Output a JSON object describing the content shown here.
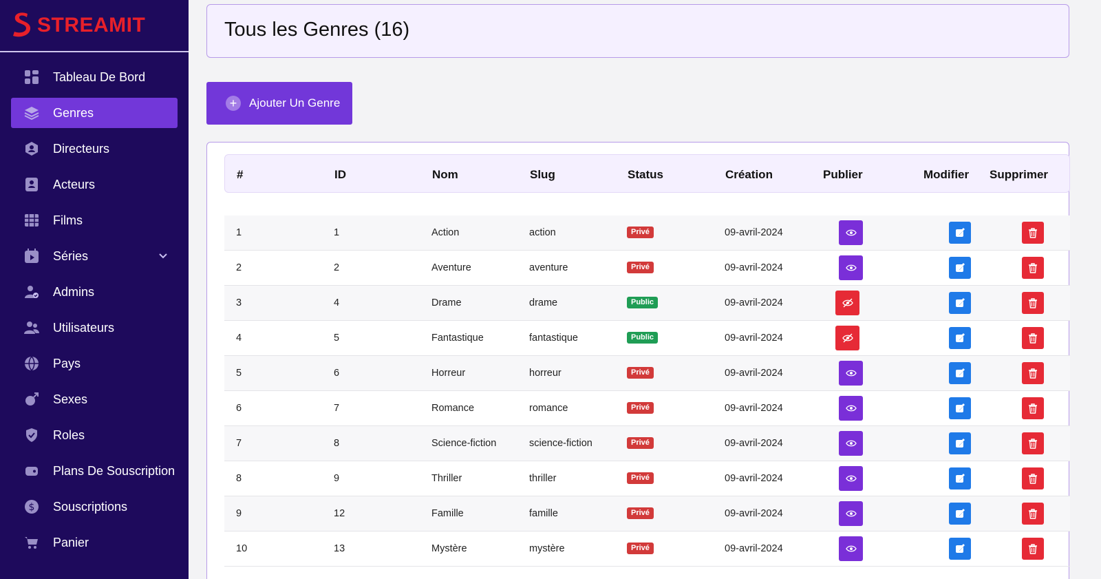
{
  "brand": {
    "name": "STREAMIT"
  },
  "sidebar": {
    "items": [
      {
        "label": "Tableau De Bord",
        "icon": "dashboard-icon",
        "active": false
      },
      {
        "label": "Genres",
        "icon": "layers-icon",
        "active": true
      },
      {
        "label": "Directeurs",
        "icon": "director-icon",
        "active": false
      },
      {
        "label": "Acteurs",
        "icon": "actor-icon",
        "active": false
      },
      {
        "label": "Films",
        "icon": "film-icon",
        "active": false
      },
      {
        "label": "Séries",
        "icon": "series-icon",
        "active": false,
        "has_submenu": true
      },
      {
        "label": "Admins",
        "icon": "admin-icon",
        "active": false
      },
      {
        "label": "Utilisateurs",
        "icon": "users-icon",
        "active": false
      },
      {
        "label": "Pays",
        "icon": "globe-icon",
        "active": false
      },
      {
        "label": "Sexes",
        "icon": "gender-icon",
        "active": false
      },
      {
        "label": "Roles",
        "icon": "shield-icon",
        "active": false
      },
      {
        "label": "Plans De Souscription",
        "icon": "plan-icon",
        "active": false
      },
      {
        "label": "Souscriptions",
        "icon": "dollar-icon",
        "active": false
      },
      {
        "label": "Panier",
        "icon": "cart-icon",
        "active": false
      }
    ]
  },
  "header": {
    "title": "Tous les Genres (16)"
  },
  "toolbar": {
    "add_label": "Ajouter Un Genre"
  },
  "table": {
    "columns": [
      "#",
      "ID",
      "Nom",
      "Slug",
      "Status",
      "Création",
      "Publier",
      "Modifier",
      "Supprimer"
    ],
    "rows": [
      {
        "n": "1",
        "id": "1",
        "name": "Action",
        "slug": "action",
        "status": "Privé",
        "created": "09-avril-2024"
      },
      {
        "n": "2",
        "id": "2",
        "name": "Aventure",
        "slug": "aventure",
        "status": "Privé",
        "created": "09-avril-2024"
      },
      {
        "n": "3",
        "id": "4",
        "name": "Drame",
        "slug": "drame",
        "status": "Public",
        "created": "09-avril-2024"
      },
      {
        "n": "4",
        "id": "5",
        "name": "Fantastique",
        "slug": "fantastique",
        "status": "Public",
        "created": "09-avril-2024"
      },
      {
        "n": "5",
        "id": "6",
        "name": "Horreur",
        "slug": "horreur",
        "status": "Privé",
        "created": "09-avril-2024"
      },
      {
        "n": "6",
        "id": "7",
        "name": "Romance",
        "slug": "romance",
        "status": "Privé",
        "created": "09-avril-2024"
      },
      {
        "n": "7",
        "id": "8",
        "name": "Science-fiction",
        "slug": "science-fiction",
        "status": "Privé",
        "created": "09-avril-2024"
      },
      {
        "n": "8",
        "id": "9",
        "name": "Thriller",
        "slug": "thriller",
        "status": "Privé",
        "created": "09-avril-2024"
      },
      {
        "n": "9",
        "id": "12",
        "name": "Famille",
        "slug": "famille",
        "status": "Privé",
        "created": "09-avril-2024"
      },
      {
        "n": "10",
        "id": "13",
        "name": "Mystère",
        "slug": "mystère",
        "status": "Privé",
        "created": "09-avril-2024"
      }
    ]
  },
  "colors": {
    "sidebar_bg": "#1e0a5c",
    "accent": "#7237d9",
    "brand_red": "#e8202a",
    "edit_blue": "#1f7ae8",
    "delete_red": "#e62a36",
    "public_green": "#1f9d55"
  }
}
